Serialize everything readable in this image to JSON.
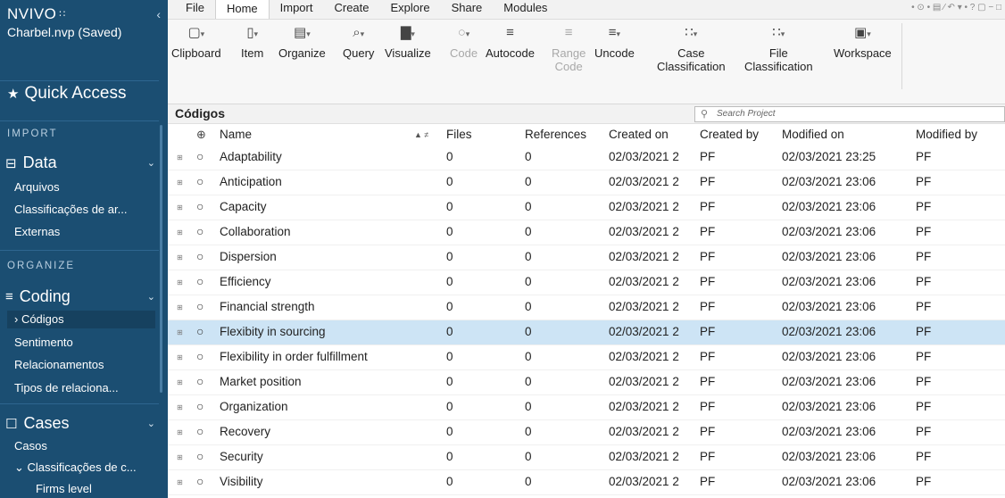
{
  "sidebar": {
    "logo": "NVIVO",
    "logo_mark": "∷",
    "collapse_glyph": "‹",
    "project": "Charbel.nvp (Saved)",
    "quick_access": "Quick Access",
    "quick_access_glyph": "★",
    "sections": {
      "import": "IMPORT",
      "organize": "ORGANIZE"
    },
    "data_group": {
      "label": "Data",
      "glyph": "⊟",
      "chevron": "⌄"
    },
    "data_items": [
      "Arquivos",
      "Classificações de ar...",
      "Externas"
    ],
    "coding_group": {
      "label": "Coding",
      "glyph": "≡",
      "chevron": "⌄"
    },
    "coding_items": [
      {
        "label": "› Códigos",
        "selected": true
      },
      {
        "label": "Sentimento"
      },
      {
        "label": "Relacionamentos"
      },
      {
        "label": "Tipos de relaciona..."
      }
    ],
    "cases_group": {
      "label": "Cases",
      "glyph": "☐",
      "chevron": "⌄"
    },
    "cases_items": [
      "Casos",
      "⌄ Classificações de c...",
      "Firms level"
    ]
  },
  "menubar": {
    "tabs": [
      "File",
      "Home",
      "Import",
      "Create",
      "Explore",
      "Share",
      "Modules"
    ],
    "active": "Home",
    "window_controls": "• ⊙ • ▤ ∕ ↶ ▾ • ? ▢ − □"
  },
  "ribbon": {
    "buttons": [
      {
        "label": "Clipboard",
        "icon": "clipboard-icon",
        "glyph": "▢",
        "enabled": true
      },
      {
        "label": "Item",
        "icon": "item-icon",
        "glyph": "▯",
        "enabled": true
      },
      {
        "label": "Organize",
        "icon": "organize-icon",
        "glyph": "▤",
        "enabled": true
      },
      {
        "label": "Query",
        "icon": "query-icon",
        "glyph": "⌕",
        "enabled": true
      },
      {
        "label": "Visualize",
        "icon": "visualize-icon",
        "glyph": "▇",
        "enabled": true
      },
      {
        "label": "Code",
        "icon": "code-icon",
        "glyph": "○",
        "enabled": false
      },
      {
        "label": "Autocode",
        "icon": "autocode-icon",
        "glyph": "≡",
        "enabled": true
      },
      {
        "label": "Range\nCode",
        "icon": "range-code-icon",
        "glyph": "≡",
        "enabled": false
      },
      {
        "label": "Uncode",
        "icon": "uncode-icon",
        "glyph": "≡",
        "enabled": true
      },
      {
        "label": "Case\nClassification",
        "icon": "case-classification-icon",
        "glyph": "∷",
        "enabled": true
      },
      {
        "label": "File\nClassification",
        "icon": "file-classification-icon",
        "glyph": "∷",
        "enabled": true
      },
      {
        "label": "Workspace",
        "icon": "workspace-icon",
        "glyph": "▣",
        "enabled": true
      }
    ],
    "dropdown_glyph": "▾"
  },
  "list": {
    "title": "Códigos",
    "search_placeholder": "Search Project",
    "columns": {
      "add": "⊕",
      "name": "Name",
      "sort": "▲ ≠",
      "files": "Files",
      "references": "References",
      "created_on": "Created on",
      "created_by": "Created by",
      "modified_on": "Modified on",
      "modified_by": "Modified by"
    },
    "rows": [
      {
        "name": "Adaptability",
        "files": "0",
        "references": "0",
        "created_on": "02/03/2021 2",
        "created_by": "PF",
        "modified_on": "02/03/2021 23:25",
        "modified_by": "PF"
      },
      {
        "name": "Anticipation",
        "files": "0",
        "references": "0",
        "created_on": "02/03/2021 2",
        "created_by": "PF",
        "modified_on": "02/03/2021 23:06",
        "modified_by": "PF"
      },
      {
        "name": "Capacity",
        "files": "0",
        "references": "0",
        "created_on": "02/03/2021 2",
        "created_by": "PF",
        "modified_on": "02/03/2021 23:06",
        "modified_by": "PF"
      },
      {
        "name": "Collaboration",
        "files": "0",
        "references": "0",
        "created_on": "02/03/2021 2",
        "created_by": "PF",
        "modified_on": "02/03/2021 23:06",
        "modified_by": "PF"
      },
      {
        "name": "Dispersion",
        "files": "0",
        "references": "0",
        "created_on": "02/03/2021 2",
        "created_by": "PF",
        "modified_on": "02/03/2021 23:06",
        "modified_by": "PF"
      },
      {
        "name": "Efficiency",
        "files": "0",
        "references": "0",
        "created_on": "02/03/2021 2",
        "created_by": "PF",
        "modified_on": "02/03/2021 23:06",
        "modified_by": "PF"
      },
      {
        "name": "Financial strength",
        "files": "0",
        "references": "0",
        "created_on": "02/03/2021 2",
        "created_by": "PF",
        "modified_on": "02/03/2021 23:06",
        "modified_by": "PF"
      },
      {
        "name": "Flexibity in sourcing",
        "files": "0",
        "references": "0",
        "created_on": "02/03/2021 2",
        "created_by": "PF",
        "modified_on": "02/03/2021 23:06",
        "modified_by": "PF",
        "selected": true
      },
      {
        "name": "Flexibility in order fulfillment",
        "files": "0",
        "references": "0",
        "created_on": "02/03/2021 2",
        "created_by": "PF",
        "modified_on": "02/03/2021 23:06",
        "modified_by": "PF"
      },
      {
        "name": "Market position",
        "files": "0",
        "references": "0",
        "created_on": "02/03/2021 2",
        "created_by": "PF",
        "modified_on": "02/03/2021 23:06",
        "modified_by": "PF"
      },
      {
        "name": "Organization",
        "files": "0",
        "references": "0",
        "created_on": "02/03/2021 2",
        "created_by": "PF",
        "modified_on": "02/03/2021 23:06",
        "modified_by": "PF"
      },
      {
        "name": "Recovery",
        "files": "0",
        "references": "0",
        "created_on": "02/03/2021 2",
        "created_by": "PF",
        "modified_on": "02/03/2021 23:06",
        "modified_by": "PF"
      },
      {
        "name": "Security",
        "files": "0",
        "references": "0",
        "created_on": "02/03/2021 2",
        "created_by": "PF",
        "modified_on": "02/03/2021 23:06",
        "modified_by": "PF"
      },
      {
        "name": "Visibility",
        "files": "0",
        "references": "0",
        "created_on": "02/03/2021 2",
        "created_by": "PF",
        "modified_on": "02/03/2021 23:06",
        "modified_by": "PF"
      }
    ],
    "expander_glyph": "⊞",
    "node_glyph": "○"
  },
  "colors": {
    "sidebar_bg": "#1b4e72",
    "selected_row": "#cde4f5",
    "accent": "#1b4e72"
  }
}
